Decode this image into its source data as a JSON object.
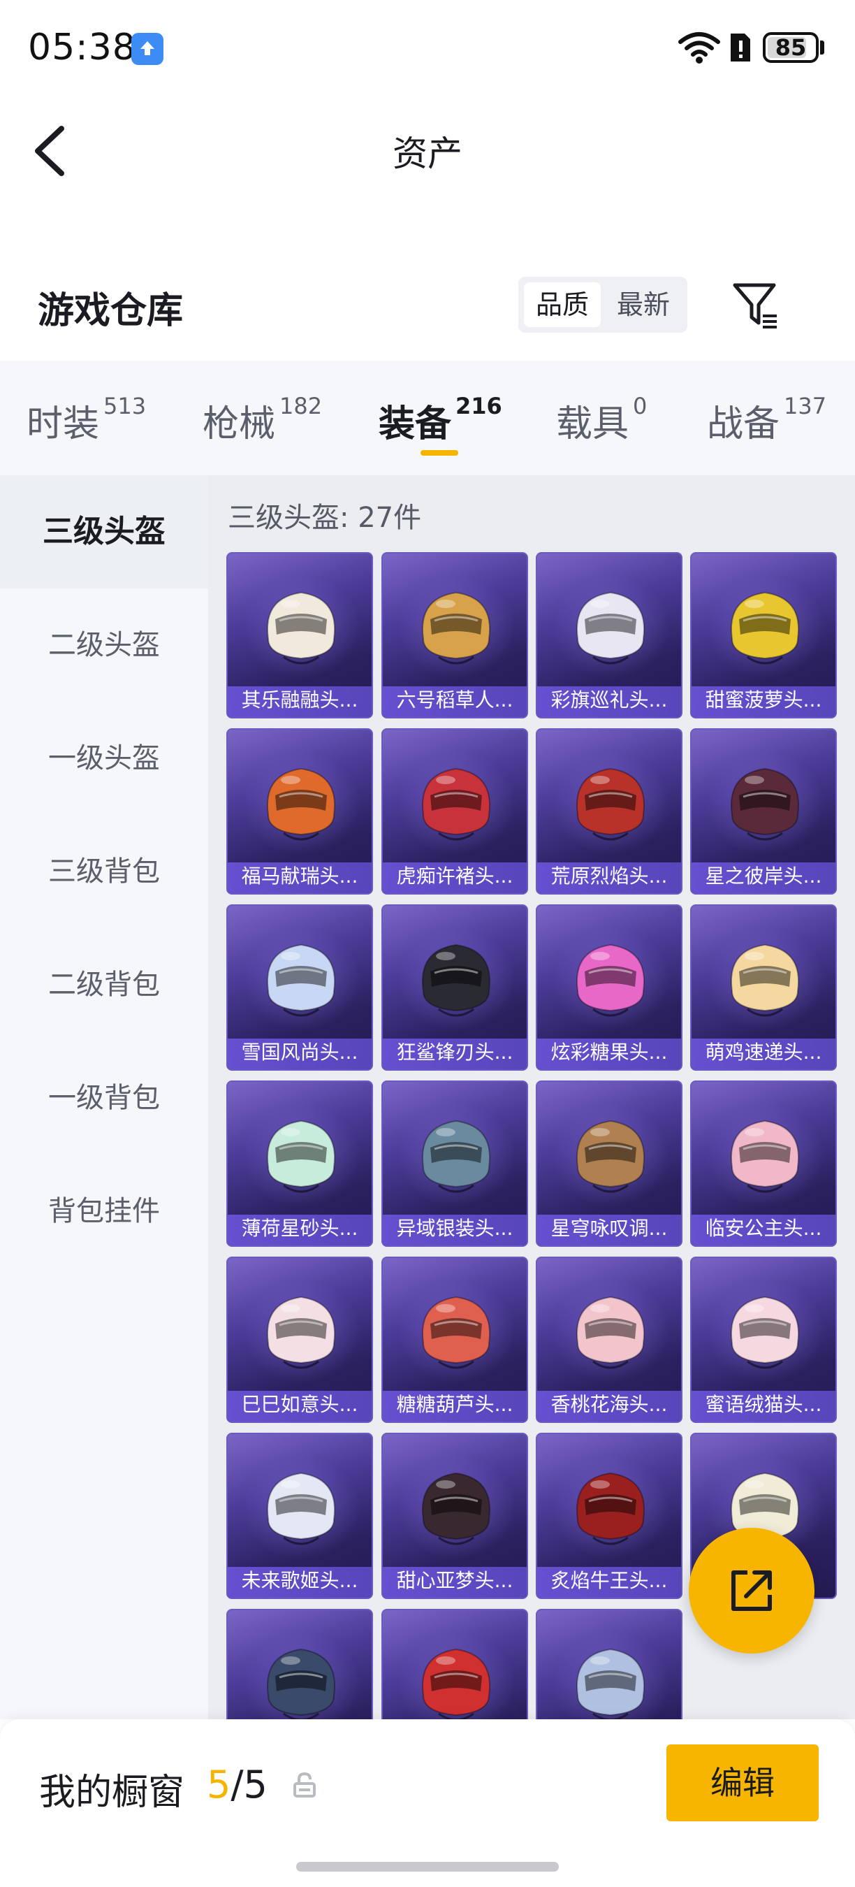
{
  "status_bar": {
    "time": "05:38",
    "battery": "85"
  },
  "header": {
    "title": "资产"
  },
  "warehouse": {
    "title": "游戏仓库",
    "sort_options": [
      "品质",
      "最新"
    ]
  },
  "tabs": [
    {
      "label": "时装",
      "count": "513"
    },
    {
      "label": "枪械",
      "count": "182"
    },
    {
      "label": "装备",
      "count": "216",
      "active": true
    },
    {
      "label": "载具",
      "count": "0"
    },
    {
      "label": "战备",
      "count": "137"
    }
  ],
  "side_nav": [
    "三级头盔",
    "二级头盔",
    "一级头盔",
    "三级背包",
    "二级背包",
    "一级背包",
    "背包挂件"
  ],
  "content": {
    "header": "三级头盔: 27件",
    "items": [
      {
        "name": "其乐融融头...",
        "color": "#f1e9dc"
      },
      {
        "name": "六号稻草人...",
        "color": "#d8a24a"
      },
      {
        "name": "彩旗巡礼头...",
        "color": "#e9e6f4"
      },
      {
        "name": "甜蜜菠萝头...",
        "color": "#e8c630"
      },
      {
        "name": "福马献瑞头...",
        "color": "#e06a2c"
      },
      {
        "name": "虎痴许褚头...",
        "color": "#c8323a"
      },
      {
        "name": "荒原烈焰头...",
        "color": "#b8322a"
      },
      {
        "name": "星之彼岸头...",
        "color": "#5a2a3a"
      },
      {
        "name": "雪国风尚头...",
        "color": "#c8d8f4"
      },
      {
        "name": "狂鲨锋刃头...",
        "color": "#2a2a32"
      },
      {
        "name": "炫彩糖果头...",
        "color": "#e868c8"
      },
      {
        "name": "萌鸡速递头...",
        "color": "#f4d8a0"
      },
      {
        "name": "薄荷星砂头...",
        "color": "#c8ecdc"
      },
      {
        "name": "异域银装头...",
        "color": "#6a8aa0"
      },
      {
        "name": "星穹咏叹调...",
        "color": "#b08050"
      },
      {
        "name": "临安公主头...",
        "color": "#f0b8c8"
      },
      {
        "name": "巳巳如意头...",
        "color": "#f4e0e4"
      },
      {
        "name": "糖糖葫芦头...",
        "color": "#e06050"
      },
      {
        "name": "香桃花海头...",
        "color": "#f2c4cc"
      },
      {
        "name": "蜜语绒猫头...",
        "color": "#f6d8e0"
      },
      {
        "name": "未来歌姬头...",
        "color": "#e4e8f4"
      },
      {
        "name": "甜心亚梦头...",
        "color": "#3a2830"
      },
      {
        "name": "炙焰牛王头...",
        "color": "#9a2020"
      },
      {
        "name": "",
        "color": "#f0ecd8"
      },
      {
        "name": "",
        "color": "#3a4a6a"
      },
      {
        "name": "",
        "color": "#d03030"
      },
      {
        "name": "",
        "color": "#b0c0e0"
      }
    ]
  },
  "showcase": {
    "label": "我的橱窗",
    "current": "5",
    "total": "/5",
    "edit_label": "编辑"
  },
  "colors": {
    "accent": "#f7b500",
    "card_bg": "#2b2160",
    "card_label": "#6a52d6"
  }
}
